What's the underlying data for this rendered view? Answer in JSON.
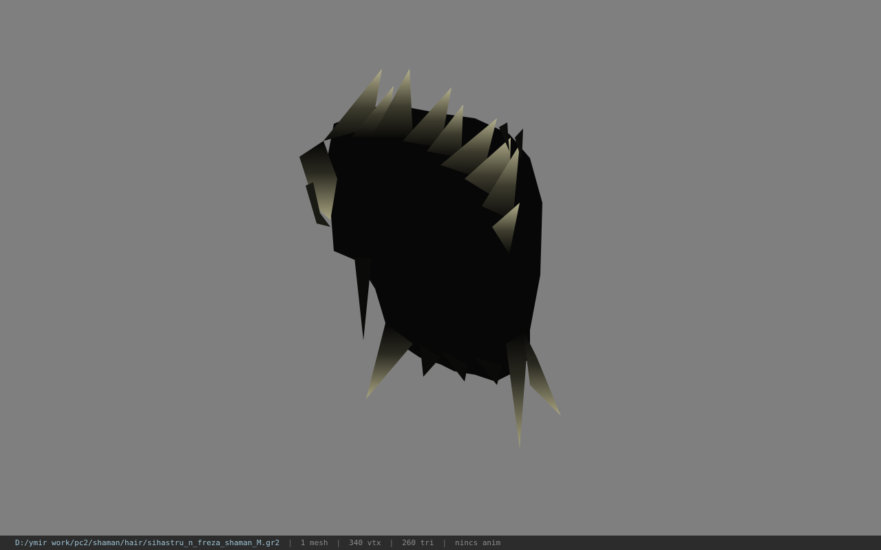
{
  "viewport": {
    "background_color": "#7f7f7f",
    "model_icon": "hair-mesh"
  },
  "status_bar": {
    "file_path": "D:/ymir work/pc2/shaman/hair/sihastru_n_freza_shaman_M.gr2",
    "separator": "|",
    "mesh_count": "1 mesh",
    "vertex_count": "340 vtx",
    "triangle_count": "260 tri",
    "animation_status": "nincs anim"
  }
}
